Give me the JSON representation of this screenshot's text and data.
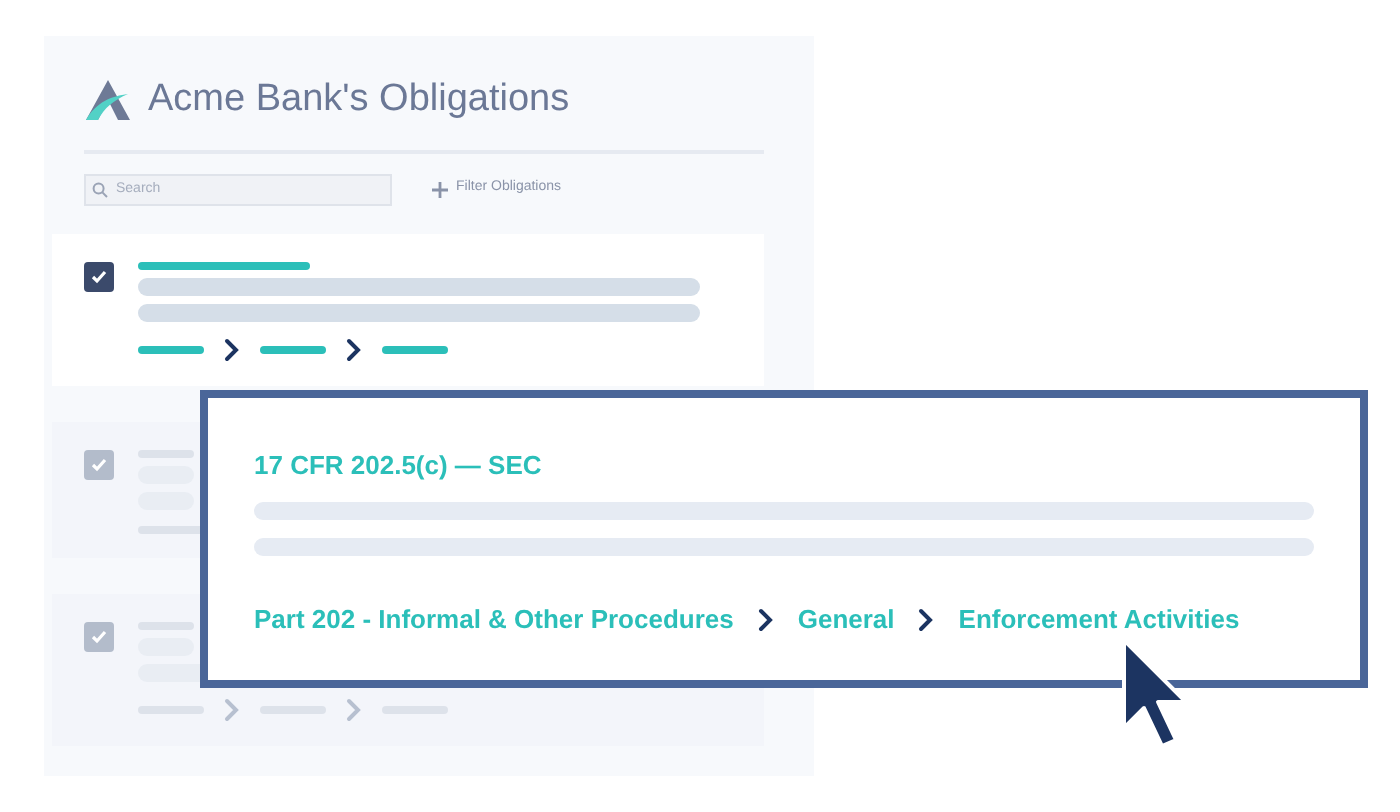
{
  "header": {
    "title": "Acme Bank's Obligations"
  },
  "search": {
    "placeholder": "Search"
  },
  "filter": {
    "label": "Filter Obligations"
  },
  "cards": [
    {
      "kind": "full",
      "checked": true,
      "dimmed": false
    },
    {
      "kind": "covered",
      "checked": true,
      "dimmed": true
    },
    {
      "kind": "partial",
      "checked": true,
      "dimmed": true
    }
  ],
  "popup": {
    "citation": "17 CFR 202.5(c) — SEC",
    "breadcrumb": [
      "Part 202 - Informal & Other Procedures",
      "General",
      "Enforcement Activities"
    ]
  }
}
